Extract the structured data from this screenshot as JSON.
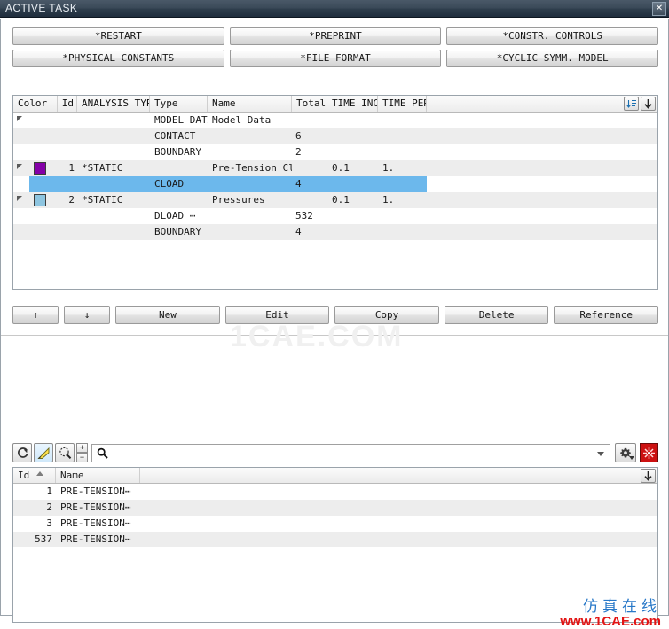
{
  "window": {
    "title": "ACTIVE TASK",
    "close_label": "✕"
  },
  "keyword_buttons": [
    [
      "*RESTART",
      "*PREPRINT",
      "*CONSTR. CONTROLS"
    ],
    [
      "*PHYSICAL CONSTANTS",
      "*FILE FORMAT",
      "*CYCLIC SYMM. MODEL"
    ]
  ],
  "task_table": {
    "columns": [
      "Color",
      "Id",
      "ANALYSIS TYPE",
      "Type",
      "Name",
      "Total",
      "TIME INC",
      "TIME PER"
    ],
    "rows": [
      {
        "expander": true,
        "color": "",
        "id": "",
        "analysis": "",
        "type": "MODEL DATA",
        "name": "Model Data",
        "total": "",
        "time_inc": "",
        "time_per": "",
        "striped": false,
        "selected": false
      },
      {
        "expander": false,
        "color": "",
        "id": "",
        "analysis": "",
        "type": "CONTACT",
        "name": "",
        "total": "6",
        "time_inc": "",
        "time_per": "",
        "striped": true,
        "selected": false
      },
      {
        "expander": false,
        "color": "",
        "id": "",
        "analysis": "",
        "type": "BOUNDARY",
        "name": "",
        "total": "2",
        "time_inc": "",
        "time_per": "",
        "striped": false,
        "selected": false
      },
      {
        "expander": true,
        "color": "#8400a8",
        "id": "1",
        "analysis": "*STATIC",
        "type": "",
        "name": "Pre-Tension Cloads",
        "total": "",
        "time_inc": "0.1",
        "time_per": "1.",
        "striped": true,
        "selected": false
      },
      {
        "expander": false,
        "color": "",
        "id": "",
        "analysis": "",
        "type": "CLOAD",
        "name": "",
        "total": "4",
        "time_inc": "",
        "time_per": "",
        "striped": false,
        "selected": true
      },
      {
        "expander": true,
        "color": "#8ec5e0",
        "id": "2",
        "analysis": "*STATIC",
        "type": "",
        "name": "Pressures",
        "total": "",
        "time_inc": "0.1",
        "time_per": "1.",
        "striped": true,
        "selected": false
      },
      {
        "expander": false,
        "color": "",
        "id": "",
        "analysis": "",
        "type": "DLOAD  ⋯",
        "name": "",
        "total": "532",
        "time_inc": "",
        "time_per": "",
        "striped": false,
        "selected": false
      },
      {
        "expander": false,
        "color": "",
        "id": "",
        "analysis": "",
        "type": "BOUNDARY",
        "name": "",
        "total": "4",
        "time_inc": "",
        "time_per": "",
        "striped": true,
        "selected": false
      }
    ],
    "header_buttons": [
      "sort-list-icon",
      "move-down-icon"
    ]
  },
  "actions": {
    "up_label": "↑",
    "down_label": "↓",
    "new_label": "New",
    "edit_label": "Edit",
    "copy_label": "Copy",
    "delete_label": "Delete",
    "reference_label": "Reference"
  },
  "toolbar": {
    "icons": [
      "refresh-icon",
      "highlight-brush-icon",
      "zoom-select-icon"
    ],
    "plus_label": "+",
    "minus_label": "−",
    "search_value": "",
    "search_placeholder": "",
    "settings_icon": "gear-icon",
    "delete_icon": "burst-delete-icon"
  },
  "entity_list": {
    "columns": [
      "Id",
      "Name"
    ],
    "rows": [
      {
        "id": "1",
        "name": "PRE-TENSION⋯",
        "striped": false
      },
      {
        "id": "2",
        "name": "PRE-TENSION⋯",
        "striped": true
      },
      {
        "id": "3",
        "name": "PRE-TENSION⋯",
        "striped": false
      },
      {
        "id": "537",
        "name": "PRE-TENSION⋯",
        "striped": true
      }
    ],
    "header_button": "move-down-icon"
  },
  "watermarks": {
    "center": "1CAE.COM",
    "chinese": "仿真在线",
    "url": "www.1CAE.com"
  },
  "colors": {
    "selection": "#6cb8ec",
    "stripe": "#ededed",
    "titlebar": "#3b4a59",
    "accent_red": "#cc1111",
    "watermark_blue": "#2878c8"
  }
}
